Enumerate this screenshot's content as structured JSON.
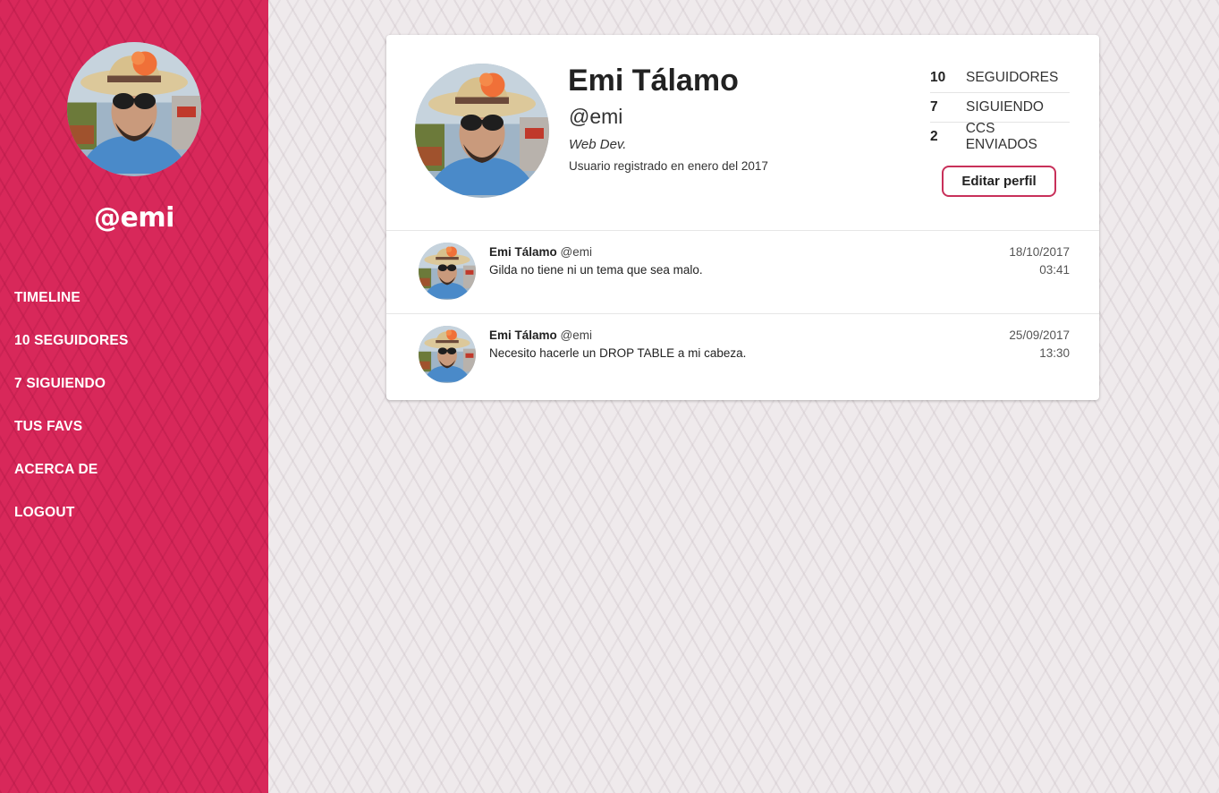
{
  "sidebar": {
    "handle": "@emi",
    "nav": [
      {
        "label": "TIMELINE"
      },
      {
        "label": "10 SEGUIDORES"
      },
      {
        "label": "7 SIGUIENDO"
      },
      {
        "label": "TUS FAVS"
      },
      {
        "label": "ACERCA DE"
      },
      {
        "label": "LOGOUT"
      }
    ]
  },
  "profile": {
    "name": "Emi Tálamo",
    "handle": "@emi",
    "bio": "Web Dev.",
    "registered": "Usuario registrado en enero del 2017",
    "stats": [
      {
        "count": "10",
        "label": "SEGUIDORES"
      },
      {
        "count": "7",
        "label": "SIGUIENDO"
      },
      {
        "count": "2",
        "label": "CCS ENVIADOS"
      }
    ],
    "edit_label": "Editar perfil"
  },
  "posts": [
    {
      "author": "Emi Tálamo",
      "handle": "@emi",
      "text": "Gilda no tiene ni un tema que sea malo.",
      "date": "18/10/2017",
      "time": "03:41"
    },
    {
      "author": "Emi Tálamo",
      "handle": "@emi",
      "text": "Necesito hacerle un DROP TABLE a mi cabeza.",
      "date": "25/09/2017",
      "time": "13:30"
    }
  ],
  "colors": {
    "sidebar": "#d8285a",
    "background": "#efeaec",
    "button_border": "#c8305a"
  }
}
